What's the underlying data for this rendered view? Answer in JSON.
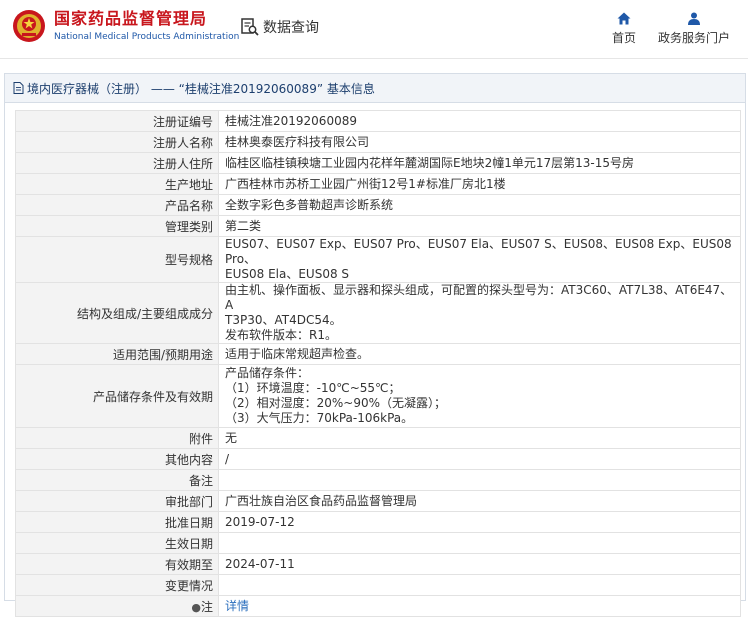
{
  "header": {
    "logo_cn": "国家药品监督管理局",
    "logo_en": "National Medical Products Administration",
    "search_label": "数据查询",
    "nav": [
      {
        "label": "首页",
        "icon": "home-icon"
      },
      {
        "label": "政务服务门户",
        "icon": "user-icon"
      }
    ]
  },
  "section": {
    "title": "境内医疗器械（注册） —— “桂械注准20192060089” 基本信息"
  },
  "rows": [
    {
      "label": "注册证编号",
      "value": "桂械注准20192060089"
    },
    {
      "label": "注册人名称",
      "value": "桂林奥泰医疗科技有限公司"
    },
    {
      "label": "注册人住所",
      "value": "临桂区临桂镇秧塘工业园内花样年麓湖国际E地块2幢1单元17层第13-15号房"
    },
    {
      "label": "生产地址",
      "value": "广西桂林市苏桥工业园广州街12号1#标准厂房北1楼"
    },
    {
      "label": "产品名称",
      "value": "全数字彩色多普勒超声诊断系统"
    },
    {
      "label": "管理类别",
      "value": "第二类"
    },
    {
      "label": "型号规格",
      "lines": [
        "EUS07、EUS07 Exp、EUS07 Pro、EUS07 Ela、EUS07 S、EUS08、EUS08 Exp、EUS08 Pro、",
        "EUS08 Ela、EUS08 S"
      ]
    },
    {
      "label": "结构及组成/主要组成成分",
      "lines": [
        "由主机、操作面板、显示器和探头组成，可配置的探头型号为：AT3C60、AT7L38、AT6E47、A",
        "T3P30、AT4DC54。",
        "发布软件版本：R1。"
      ]
    },
    {
      "label": "适用范围/预期用途",
      "value": "适用于临床常规超声检查。"
    },
    {
      "label": "产品储存条件及有效期",
      "lines": [
        "产品储存条件：",
        "（1）环境温度：-10℃~55℃；",
        "（2）相对湿度：20%~90%（无凝露）；",
        "（3）大气压力：70kPa-106kPa。"
      ]
    },
    {
      "label": "附件",
      "value": "无"
    },
    {
      "label": "其他内容",
      "value": "/"
    },
    {
      "label": "备注",
      "value": ""
    },
    {
      "label": "审批部门",
      "value": "广西壮族自治区食品药品监督管理局"
    },
    {
      "label": "批准日期",
      "value": "2019-07-12"
    },
    {
      "label": "生效日期",
      "value": ""
    },
    {
      "label": "有效期至",
      "value": "2024-07-11"
    },
    {
      "label": "变更情况",
      "value": ""
    },
    {
      "label": "注",
      "value": "详情",
      "icon": "pin-icon"
    }
  ]
}
